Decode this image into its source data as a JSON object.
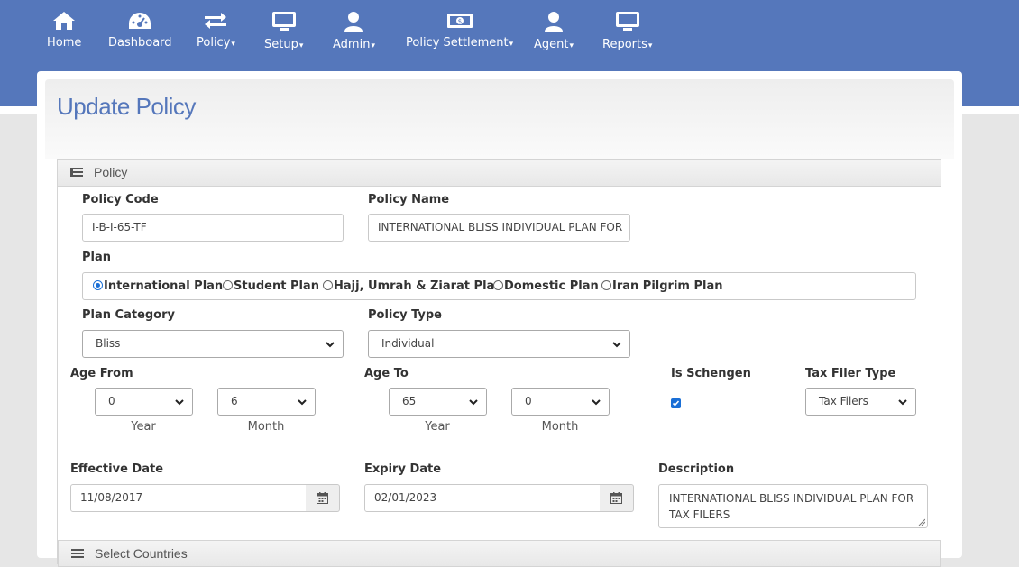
{
  "nav": {
    "home": "Home",
    "dashboard": "Dashboard",
    "policy": "Policy",
    "setup": "Setup",
    "admin": "Admin",
    "policy_settlement": "Policy Settlement",
    "agent": "Agent",
    "reports": "Reports",
    "caret": "▾"
  },
  "page": {
    "title": "Update Policy"
  },
  "section": {
    "title": "Policy",
    "next_title": "Select Countries"
  },
  "form": {
    "policy_code_label": "Policy Code",
    "policy_code_value": "I-B-I-65-TF",
    "policy_name_label": "Policy Name",
    "policy_name_value": "INTERNATIONAL BLISS INDIVIDUAL PLAN FOR",
    "plan_label": "Plan",
    "plan_options": [
      "International Plan",
      "Student Plan",
      "Hajj, Umrah & Ziarat Plan",
      "Domestic Plan",
      "Iran Pilgrim Plan"
    ],
    "plan_selected": "International Plan",
    "plan_category_label": "Plan Category",
    "plan_category_value": "Bliss",
    "policy_type_label": "Policy Type",
    "policy_type_value": "Individual",
    "age_from_label": "Age From",
    "age_from_year": "0",
    "age_from_month": "6",
    "age_to_label": "Age To",
    "age_to_year": "65",
    "age_to_month": "0",
    "year_label": "Year",
    "month_label": "Month",
    "is_schengen_label": "Is Schengen",
    "is_schengen_checked": true,
    "tax_filer_type_label": "Tax Filer Type",
    "tax_filer_type_value": "Tax Filers",
    "effective_date_label": "Effective Date",
    "effective_date_value": "11/08/2017",
    "expiry_date_label": "Expiry Date",
    "expiry_date_value": "02/01/2023",
    "description_label": "Description",
    "description_value": "INTERNATIONAL BLISS INDIVIDUAL PLAN FOR TAX FILERS"
  },
  "colors": {
    "brand": "#5577bb",
    "accent": "#1a6fd6"
  }
}
